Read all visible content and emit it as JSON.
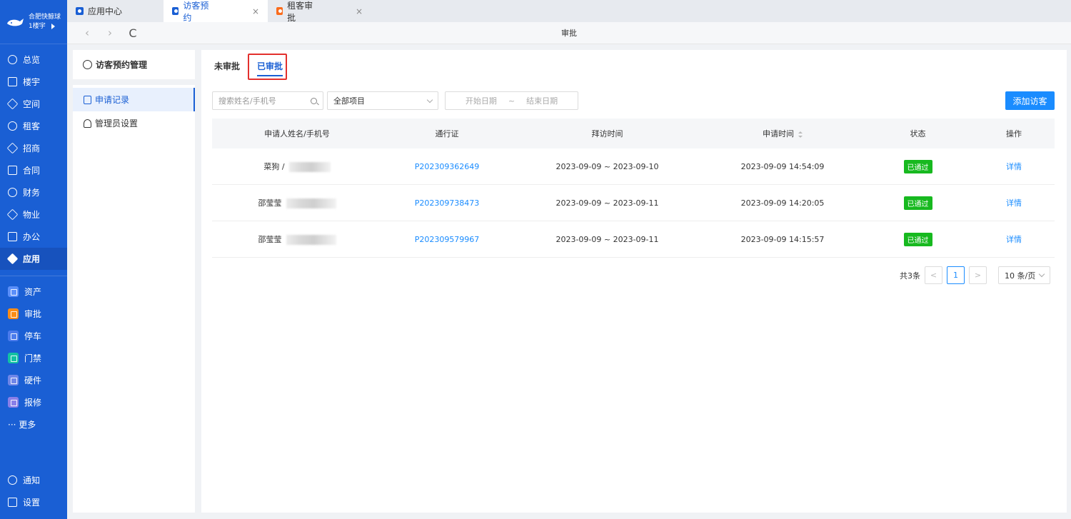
{
  "brand": {
    "name": "合肥快鲸球",
    "building": "1楼宇"
  },
  "nav": {
    "primary": [
      {
        "label": "总览",
        "icon": "dashboard-icon"
      },
      {
        "label": "楼宇",
        "icon": "building-icon"
      },
      {
        "label": "空间",
        "icon": "space-icon"
      },
      {
        "label": "租客",
        "icon": "tenant-icon"
      },
      {
        "label": "招商",
        "icon": "tag-icon"
      },
      {
        "label": "合同",
        "icon": "contract-icon"
      },
      {
        "label": "财务",
        "icon": "finance-icon"
      },
      {
        "label": "物业",
        "icon": "home-icon"
      },
      {
        "label": "办公",
        "icon": "monitor-icon"
      },
      {
        "label": "应用",
        "icon": "app-icon"
      }
    ],
    "apps": [
      {
        "label": "资产",
        "color": "#5b8ff9"
      },
      {
        "label": "审批",
        "color": "#fa8c16"
      },
      {
        "label": "停车",
        "color": "#4b7bec"
      },
      {
        "label": "门禁",
        "color": "#13c2a3"
      },
      {
        "label": "硬件",
        "color": "#6f86e8"
      },
      {
        "label": "报修",
        "color": "#8a7fe8"
      }
    ],
    "more": "··· 更多",
    "bottom": [
      {
        "label": "通知",
        "icon": "bell-icon"
      },
      {
        "label": "设置",
        "icon": "menu-icon"
      }
    ]
  },
  "tabs": [
    {
      "label": "应用中心",
      "color": "#1a5fd4"
    },
    {
      "label": "访客预约",
      "color": "#1a5fd4"
    },
    {
      "label": "租客审批",
      "color": "#fa6c1d"
    }
  ],
  "tab_close": "×",
  "address": {
    "title": "审批",
    "back": "‹",
    "forward": "›",
    "reload": "C"
  },
  "submenu": {
    "title": "访客预约管理",
    "items": [
      "申请记录",
      "管理员设置"
    ]
  },
  "content_tabs": [
    "未审批",
    "已审批"
  ],
  "filters": {
    "search_placeholder": "搜索姓名/手机号",
    "project": "全部项目",
    "date_start": "开始日期",
    "date_sep": "~",
    "date_end": "结束日期"
  },
  "add_button": "添加访客",
  "table": {
    "headers": [
      "申请人姓名/手机号",
      "通行证",
      "拜访时间",
      "申请时间",
      "状态",
      "操作"
    ],
    "rows": [
      {
        "name": "菜狗 /",
        "pass": "P202309362649",
        "visit": "2023-09-09 ~ 2023-09-10",
        "applied": "2023-09-09 14:54:09",
        "status": "已通过",
        "action": "详情"
      },
      {
        "name": "邵莹莹",
        "pass": "P202309738473",
        "visit": "2023-09-09 ~ 2023-09-11",
        "applied": "2023-09-09 14:20:05",
        "status": "已通过",
        "action": "详情"
      },
      {
        "name": "邵莹莹",
        "pass": "P202309579967",
        "visit": "2023-09-09 ~ 2023-09-11",
        "applied": "2023-09-09 14:15:57",
        "status": "已通过",
        "action": "详情"
      }
    ]
  },
  "pagination": {
    "total": "共3条",
    "prev": "<",
    "page": "1",
    "next": ">",
    "size": "10 条/页"
  }
}
